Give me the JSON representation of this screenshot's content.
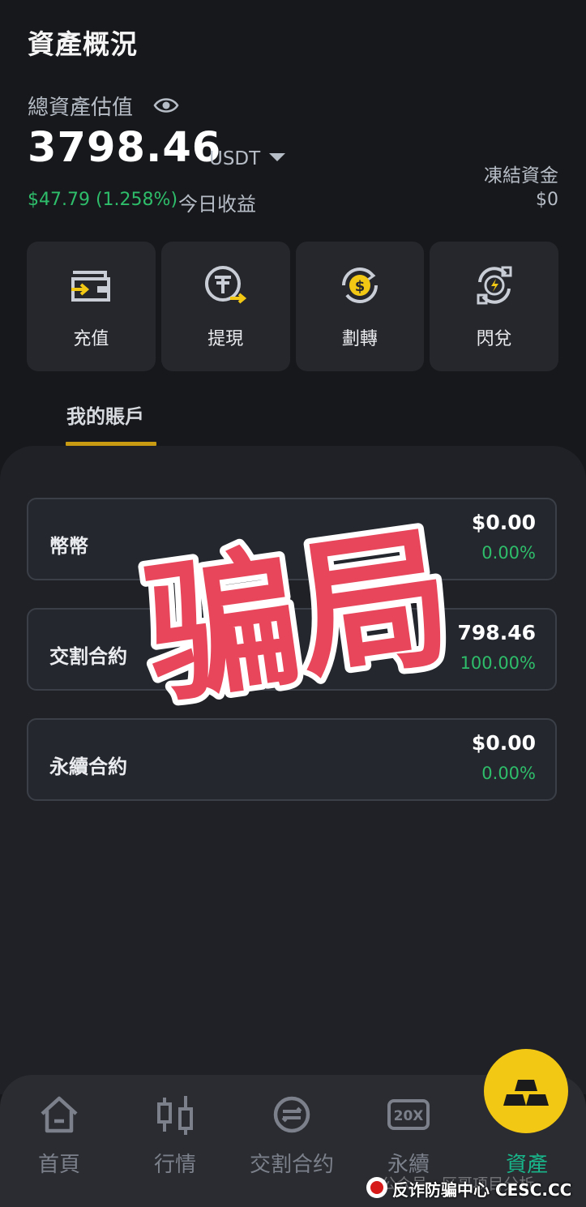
{
  "header": {
    "title": "資產概況",
    "total_label": "總資產估值",
    "total_value": "3798.46",
    "total_unit": "USDT",
    "pnl_value": "$47.79 (1.258%)",
    "pnl_label": "今日收益",
    "frozen_label": "凍結資金",
    "frozen_value": "$0"
  },
  "actions": [
    {
      "label": "充值",
      "icon": "deposit-wallet-icon"
    },
    {
      "label": "提現",
      "icon": "withdraw-tether-icon"
    },
    {
      "label": "劃轉",
      "icon": "transfer-dollar-icon"
    },
    {
      "label": "閃兌",
      "icon": "flash-swap-icon"
    }
  ],
  "tabs": {
    "my_accounts": "我的賬戶"
  },
  "accounts": [
    {
      "name": "幣幣",
      "amount": "$0.00",
      "percent": "0.00%"
    },
    {
      "name": "交割合約",
      "amount": "798.46",
      "percent": "100.00%"
    },
    {
      "name": "永續合約",
      "amount": "$0.00",
      "percent": "0.00%"
    }
  ],
  "stamp": {
    "text": "骗局"
  },
  "bottom_nav": [
    {
      "label": "首頁",
      "icon": "home-icon"
    },
    {
      "label": "行情",
      "icon": "candlestick-icon"
    },
    {
      "label": "交割合约",
      "icon": "contract-icon"
    },
    {
      "label": "永續",
      "icon": "20x-icon"
    },
    {
      "label": "資產",
      "icon": "gold-bars-icon",
      "active": true
    }
  ],
  "watermark": {
    "faint": "公众号 · 区哥项目分析",
    "main": "反诈防骗中心  CESC.CC"
  },
  "colors": {
    "positive": "#2ebd6a",
    "accent": "#f3c814",
    "active_nav": "#18b68a",
    "stamp_red": "#e8465a"
  }
}
